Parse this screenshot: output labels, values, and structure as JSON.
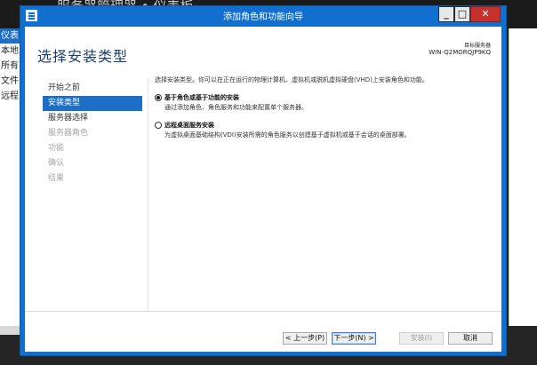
{
  "background_window": {
    "title": "服务器管理器 • 仪表板",
    "nav_items": [
      "仪表",
      "本地",
      "所有",
      "文件",
      "远程"
    ]
  },
  "wizard": {
    "title": "添加角色和功能向导",
    "page_title": "选择安装类型",
    "destination_label": "目标服务器",
    "destination_server": "WIN-Q2MORQJP9KQ",
    "steps": [
      {
        "label": "开始之前",
        "state": "normal"
      },
      {
        "label": "安装类型",
        "state": "active"
      },
      {
        "label": "服务器选择",
        "state": "normal"
      },
      {
        "label": "服务器角色",
        "state": "disabled"
      },
      {
        "label": "功能",
        "state": "disabled"
      },
      {
        "label": "确认",
        "state": "disabled"
      },
      {
        "label": "结果",
        "state": "disabled"
      }
    ],
    "intro_text": "选择安装类型。你可以在正在运行的物理计算机、虚拟机或脱机虚拟硬盘(VHD)上安装角色和功能。",
    "options": [
      {
        "title": "基于角色或基于功能的安装",
        "description": "通过添加角色、角色服务和功能来配置单个服务器。",
        "selected": true
      },
      {
        "title": "远程桌面服务安装",
        "description": "为虚拟桌面基础结构(VDI)安装所需的角色服务以创建基于虚拟机或基于会话的桌面部署。",
        "selected": false
      }
    ],
    "buttons": {
      "previous": "< 上一步(P)",
      "next": "下一步(N) >",
      "install": "安装(I)",
      "cancel": "取消"
    }
  },
  "colors": {
    "window_frame": "#1170cf",
    "active_step": "#1c6fc5",
    "close_button": "#c7312b"
  }
}
